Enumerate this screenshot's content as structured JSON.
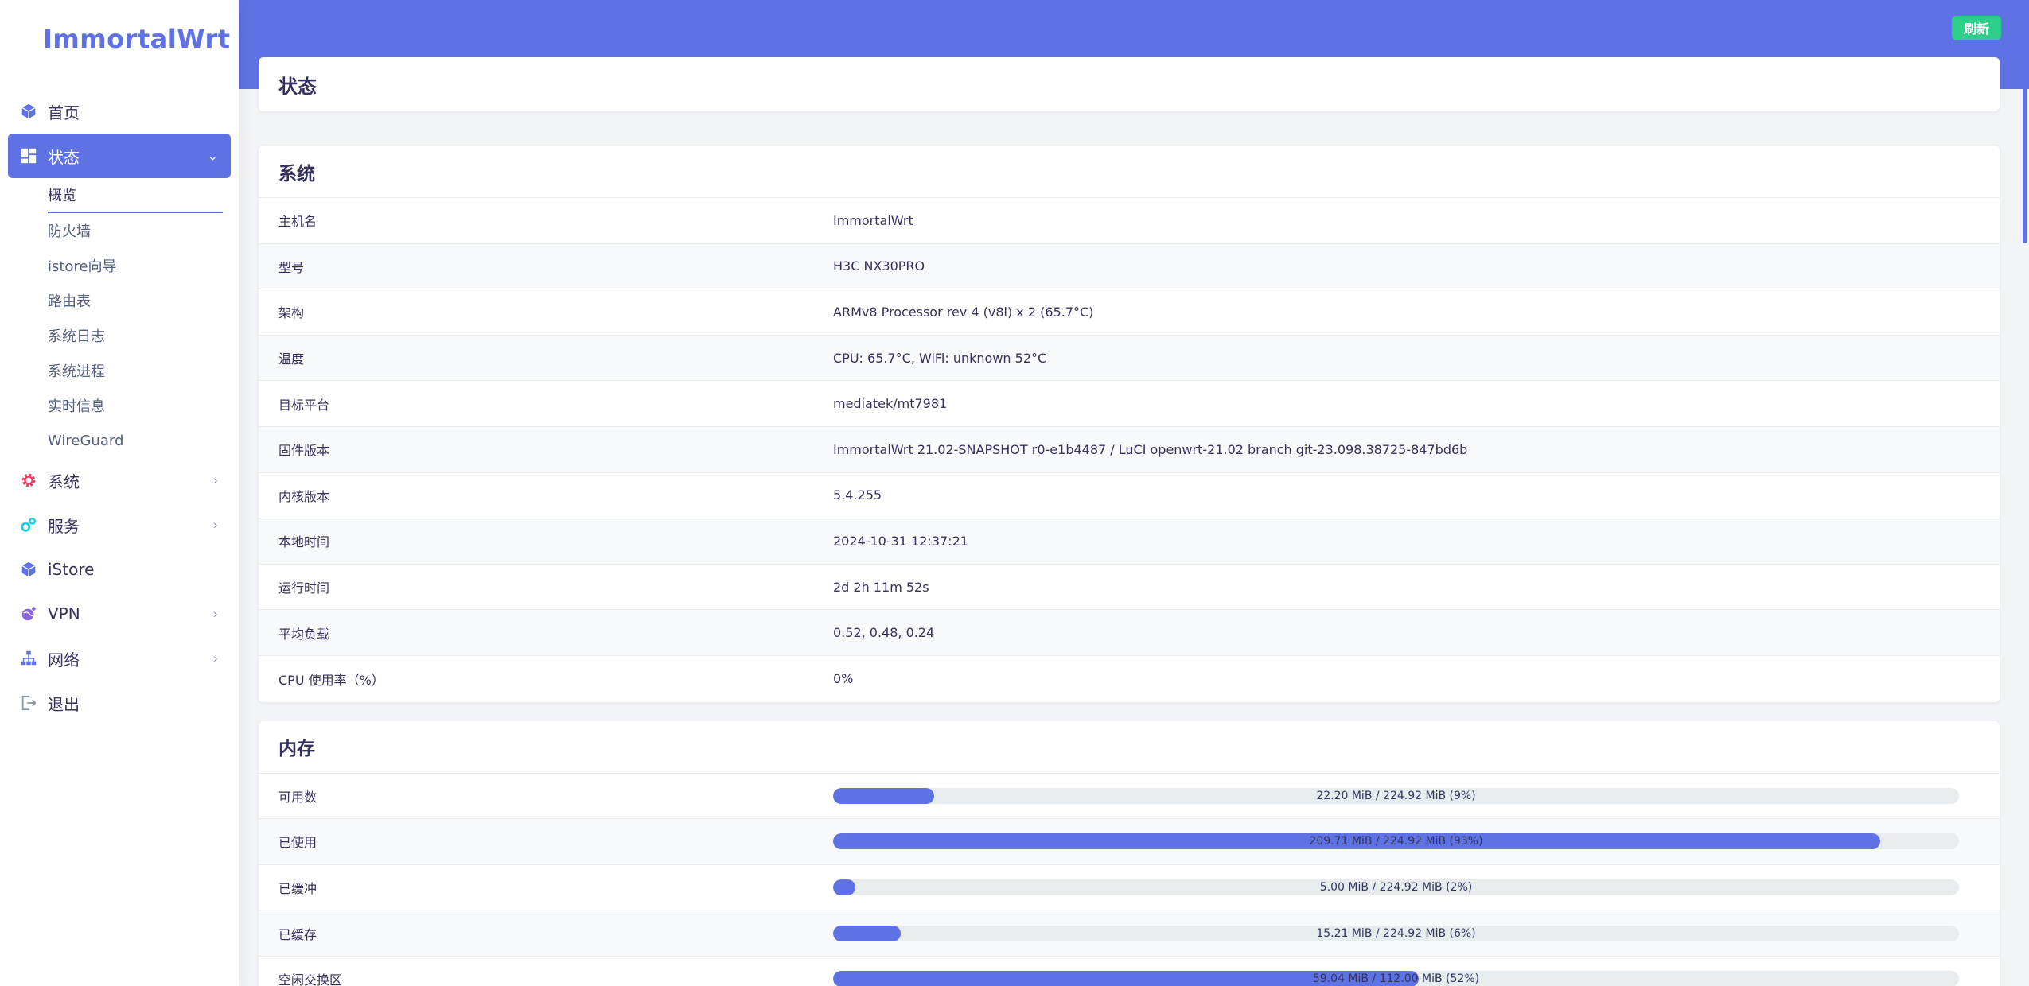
{
  "app": {
    "logo_text": "ImmortalWrt"
  },
  "sidebar": {
    "items": [
      {
        "label": "首页",
        "icon": "cube-icon",
        "color": "#5e72e4"
      },
      {
        "label": "状态",
        "icon": "dashboard-icon",
        "color": "#ffffff",
        "active": true
      },
      {
        "label": "系统",
        "icon": "gear-icon",
        "color": "#f5365c"
      },
      {
        "label": "服务",
        "icon": "gears-icon",
        "color": "#11cdef"
      },
      {
        "label": "iStore",
        "icon": "cube-icon",
        "color": "#5e72e4"
      },
      {
        "label": "VPN",
        "icon": "globe-icon",
        "color": "#8965e0"
      },
      {
        "label": "网络",
        "icon": "sitemap-icon",
        "color": "#5e72e4"
      },
      {
        "label": "退出",
        "icon": "logout-icon",
        "color": "#8898aa"
      }
    ],
    "status_submenu": [
      "概览",
      "防火墙",
      "istore向导",
      "路由表",
      "系统日志",
      "系统进程",
      "实时信息",
      "WireGuard"
    ]
  },
  "header": {
    "refresh_label": "刷新",
    "accent": "#5e72e4",
    "button_color": "#2dce89"
  },
  "page": {
    "title": "状态"
  },
  "system": {
    "title": "系统",
    "rows": [
      {
        "key": "主机名",
        "value": "ImmortalWrt"
      },
      {
        "key": "型号",
        "value": "H3C NX30PRO"
      },
      {
        "key": "架构",
        "value": "ARMv8 Processor rev 4 (v8l) x 2 (65.7°C)"
      },
      {
        "key": "温度",
        "value": "CPU: 65.7°C, WiFi: unknown 52°C"
      },
      {
        "key": "目标平台",
        "value": "mediatek/mt7981"
      },
      {
        "key": "固件版本",
        "value": "ImmortalWrt 21.02-SNAPSHOT r0-e1b4487 / LuCI openwrt-21.02 branch git-23.098.38725-847bd6b"
      },
      {
        "key": "内核版本",
        "value": "5.4.255"
      },
      {
        "key": "本地时间",
        "value": "2024-10-31 12:37:21"
      },
      {
        "key": "运行时间",
        "value": "2d 2h 11m 52s"
      },
      {
        "key": "平均负载",
        "value": "0.52, 0.48, 0.24"
      },
      {
        "key": "CPU 使用率（%）",
        "value": "0%"
      }
    ]
  },
  "memory": {
    "title": "内存",
    "rows": [
      {
        "key": "可用数",
        "text": "22.20 MiB / 224.92 MiB (9%)",
        "percent": 9
      },
      {
        "key": "已使用",
        "text": "209.71 MiB / 224.92 MiB (93%)",
        "percent": 93
      },
      {
        "key": "已缓冲",
        "text": "5.00 MiB / 224.92 MiB (2%)",
        "percent": 2
      },
      {
        "key": "已缓存",
        "text": "15.21 MiB / 224.92 MiB (6%)",
        "percent": 6
      },
      {
        "key": "空闲交换区",
        "text": "59.04 MiB / 112.00 MiB (52%)",
        "percent": 52
      }
    ]
  }
}
